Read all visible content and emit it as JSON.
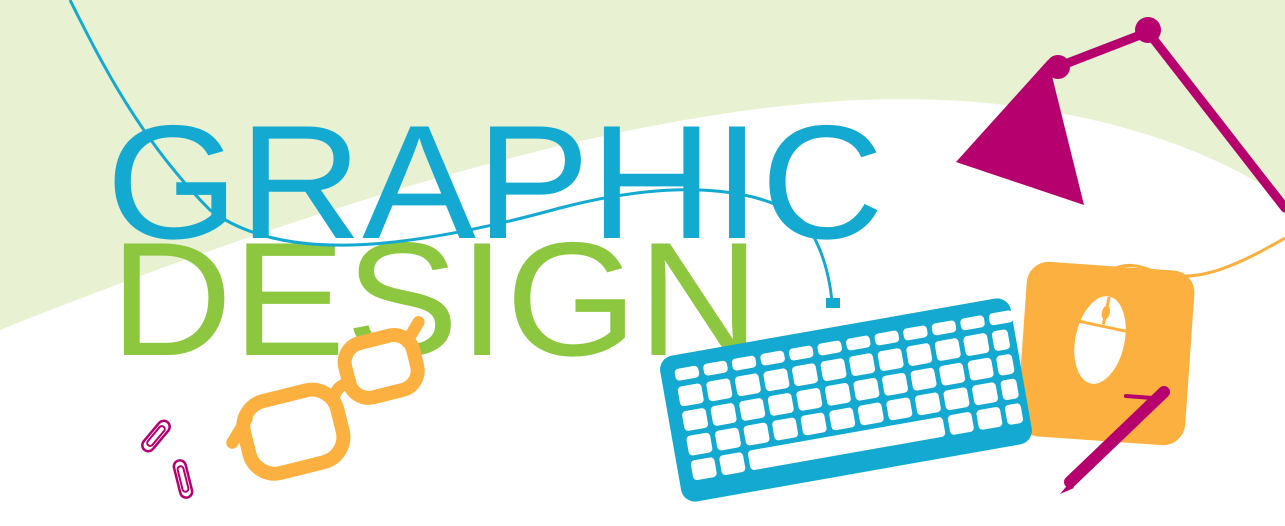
{
  "banner": {
    "line1": "GRAPHIC",
    "line2": "DESIGN"
  },
  "colors": {
    "background_green": "#e8f2d2",
    "blue": "#14a9d0",
    "green": "#8dc63f",
    "magenta": "#b5006e",
    "orange": "#fbb03f",
    "white": "#ffffff"
  },
  "icons": [
    "desk-lamp-icon",
    "keyboard-icon",
    "mouse-icon",
    "mouse-pad-icon",
    "pen-icon",
    "glasses-icon",
    "paperclip-icon"
  ]
}
